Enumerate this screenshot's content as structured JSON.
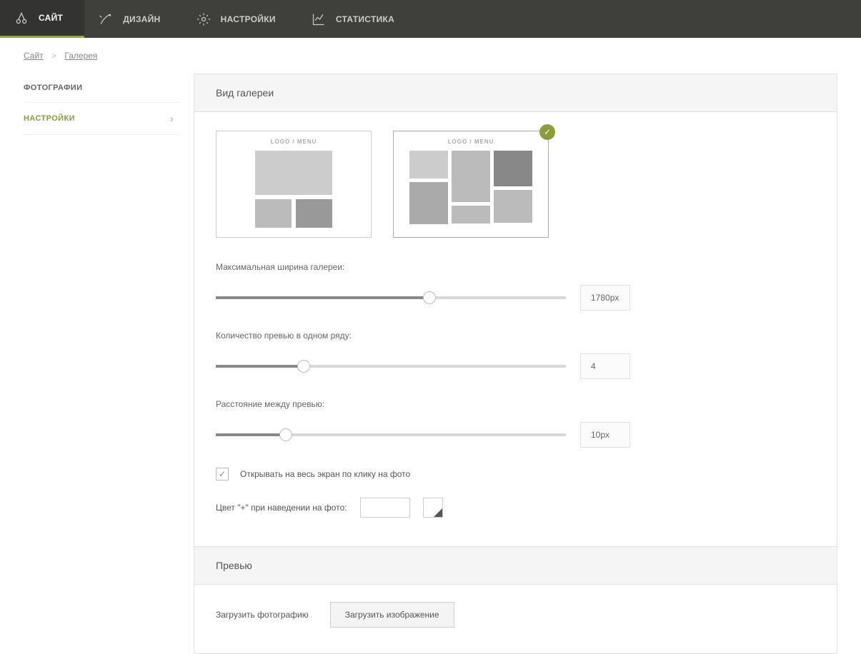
{
  "topnav": {
    "items": [
      {
        "label": "САЙТ"
      },
      {
        "label": "ДИЗАЙН"
      },
      {
        "label": "НАСТРОЙКИ"
      },
      {
        "label": "СТАТИСТИКА"
      }
    ]
  },
  "breadcrumb": {
    "a": "Сайт",
    "b": "Галерея"
  },
  "sidebar": {
    "items": [
      {
        "label": "ФОТОГРАФИИ"
      },
      {
        "label": "НАСТРОЙКИ"
      }
    ]
  },
  "section": {
    "gallery_view": "Вид галереи",
    "layout_logo_label": "LOGO / MENU",
    "max_width_label": "Максимальная ширина галереи:",
    "max_width_value": "1780px",
    "per_row_label": "Количество превью в одном ряду:",
    "per_row_value": "4",
    "gap_label": "Расстояние между превью:",
    "gap_value": "10px",
    "fullscreen_label": "Открывать на весь экран по клику на фото",
    "plus_color_label": "Цвет \"+\" при наведении на фото:"
  },
  "preview": {
    "title": "Превью",
    "upload_label": "Загрузить фотографию",
    "upload_button": "Загрузить изображение"
  }
}
